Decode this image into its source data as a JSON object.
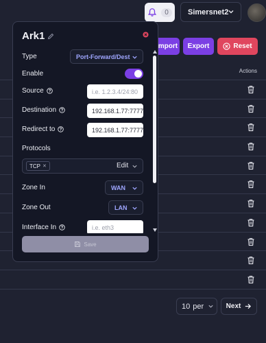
{
  "header": {
    "notification_count": "0",
    "org_name": "Simersnet2"
  },
  "actions": {
    "import_label": "Import",
    "export_label": "Export",
    "reset_label": "Reset"
  },
  "table": {
    "actions_header": "Actions",
    "row_count": 11
  },
  "pagination": {
    "per_page_value": "10",
    "per_page_suffix": "per",
    "next_label": "Next"
  },
  "modal": {
    "title": "Ark1",
    "type_label": "Type",
    "type_value": "Port-Forward/Dest",
    "enable_label": "Enable",
    "enabled": true,
    "source_label": "Source",
    "source_placeholder": "i.e. 1.2.3.4/24:80",
    "destination_label": "Destination",
    "destination_value": "192.168.1.77:7777",
    "redirect_label": "Redirect to",
    "redirect_value": "192.168.1.77:7777",
    "protocols_label": "Protocols",
    "protocol_chip": "TCP",
    "protocol_edit": "Edit",
    "zone_in_label": "Zone In",
    "zone_in_value": "WAN",
    "zone_out_label": "Zone Out",
    "zone_out_value": "LAN",
    "interface_in_label": "Interface In",
    "interface_in_placeholder": "i.e. eth3",
    "save_label": "Save"
  },
  "colors": {
    "background": "#1f2231",
    "modal_bg": "#141725",
    "primary": "#7b3fe4",
    "danger": "#e0465e",
    "select_text": "#9fa6ff"
  }
}
